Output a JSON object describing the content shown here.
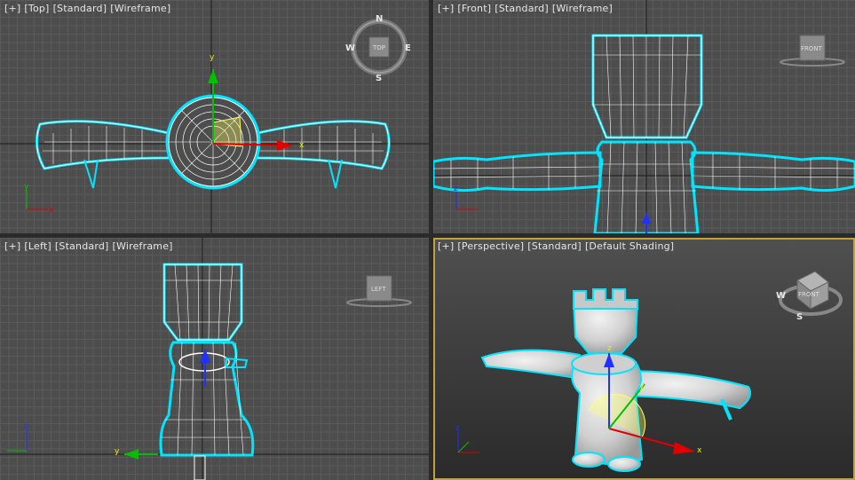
{
  "viewports": {
    "top": {
      "plus": "[+]",
      "view": "[Top]",
      "mode": "[Standard]",
      "shading": "[Wireframe]",
      "cube": "TOP"
    },
    "front": {
      "plus": "[+]",
      "view": "[Front]",
      "mode": "[Standard]",
      "shading": "[Wireframe]",
      "cube": "FRONT"
    },
    "left": {
      "plus": "[+]",
      "view": "[Left]",
      "mode": "[Standard]",
      "shading": "[Wireframe]",
      "cube": "LEFT"
    },
    "perspective": {
      "plus": "[+]",
      "view": "[Perspective]",
      "mode": "[Standard]",
      "shading": "[Default Shading]",
      "cube": "FRONT"
    }
  },
  "compass": {
    "n": "N",
    "s": "S",
    "e": "E",
    "w": "W"
  },
  "axes": {
    "x": "x",
    "y": "y",
    "z": "z"
  },
  "colors": {
    "selection": "#00e5ff",
    "wire": "#ffffff",
    "active_border": "#bfa23a",
    "axis_x": "#e00000",
    "axis_y": "#00c000",
    "axis_z": "#2030ff"
  }
}
